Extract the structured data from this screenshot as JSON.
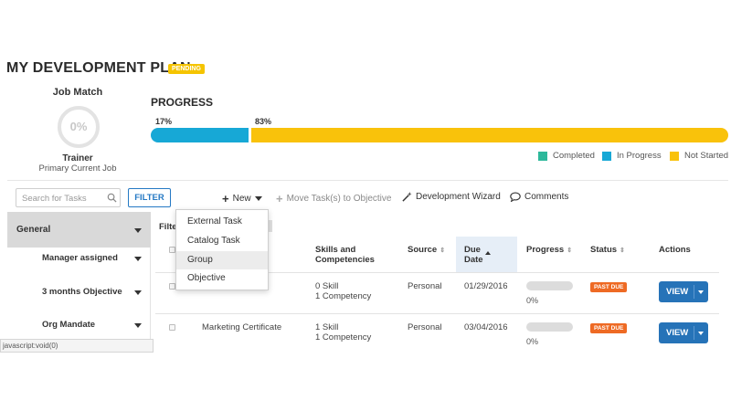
{
  "header": {
    "title": "MY DEVELOPMENT PLAN",
    "badge": "PENDING"
  },
  "job_match": {
    "label": "Job Match",
    "percent_text": "0%",
    "job_title": "Trainer",
    "job_sub": "Primary Current Job"
  },
  "progress": {
    "heading": "PROGRESS",
    "completed_pct": 0,
    "in_progress_pct": 17,
    "not_started_pct": 83,
    "in_progress_label": "17%",
    "not_started_label": "83%",
    "legend": [
      {
        "label": "Completed",
        "color": "#2db89b"
      },
      {
        "label": "In Progress",
        "color": "#17a8d6"
      },
      {
        "label": "Not Started",
        "color": "#f9c20b"
      }
    ]
  },
  "toolbar": {
    "search_placeholder": "Search for Tasks",
    "filter_label": "FILTER",
    "new_label": "New",
    "move_label": "Move Task(s) to Objective",
    "wizard_label": "Development Wizard",
    "comments_label": "Comments"
  },
  "sidebar": {
    "general": "General",
    "items": [
      {
        "label": "Manager assigned"
      },
      {
        "label": "3 months Objective"
      },
      {
        "label": "Org Mandate"
      }
    ]
  },
  "table": {
    "filter_label": "Filte",
    "headers": {
      "skills": "Skills and Competencies",
      "source": "Source",
      "due": "Due Date",
      "progress": "Progress",
      "status": "Status",
      "actions": "Actions"
    },
    "rows": [
      {
        "title": "",
        "skills1": "0 Skill",
        "skills2": "1 Competency",
        "source": "Personal",
        "due": "01/29/2016",
        "progress_text": "0%",
        "progress_value": 0,
        "status": "PAST DUE",
        "action": "VIEW"
      },
      {
        "title": "Marketing Certificate",
        "skills1": "1 Skill",
        "skills2": "1 Competency",
        "source": "Personal",
        "due": "03/04/2016",
        "progress_text": "0%",
        "progress_value": 0,
        "status": "PAST DUE",
        "action": "VIEW"
      }
    ]
  },
  "dropdown": {
    "items": [
      "External Task",
      "Catalog Task",
      "Group",
      "Objective"
    ],
    "highlighted": "Group"
  },
  "statusbar": {
    "text": "javascript:void(0)"
  }
}
